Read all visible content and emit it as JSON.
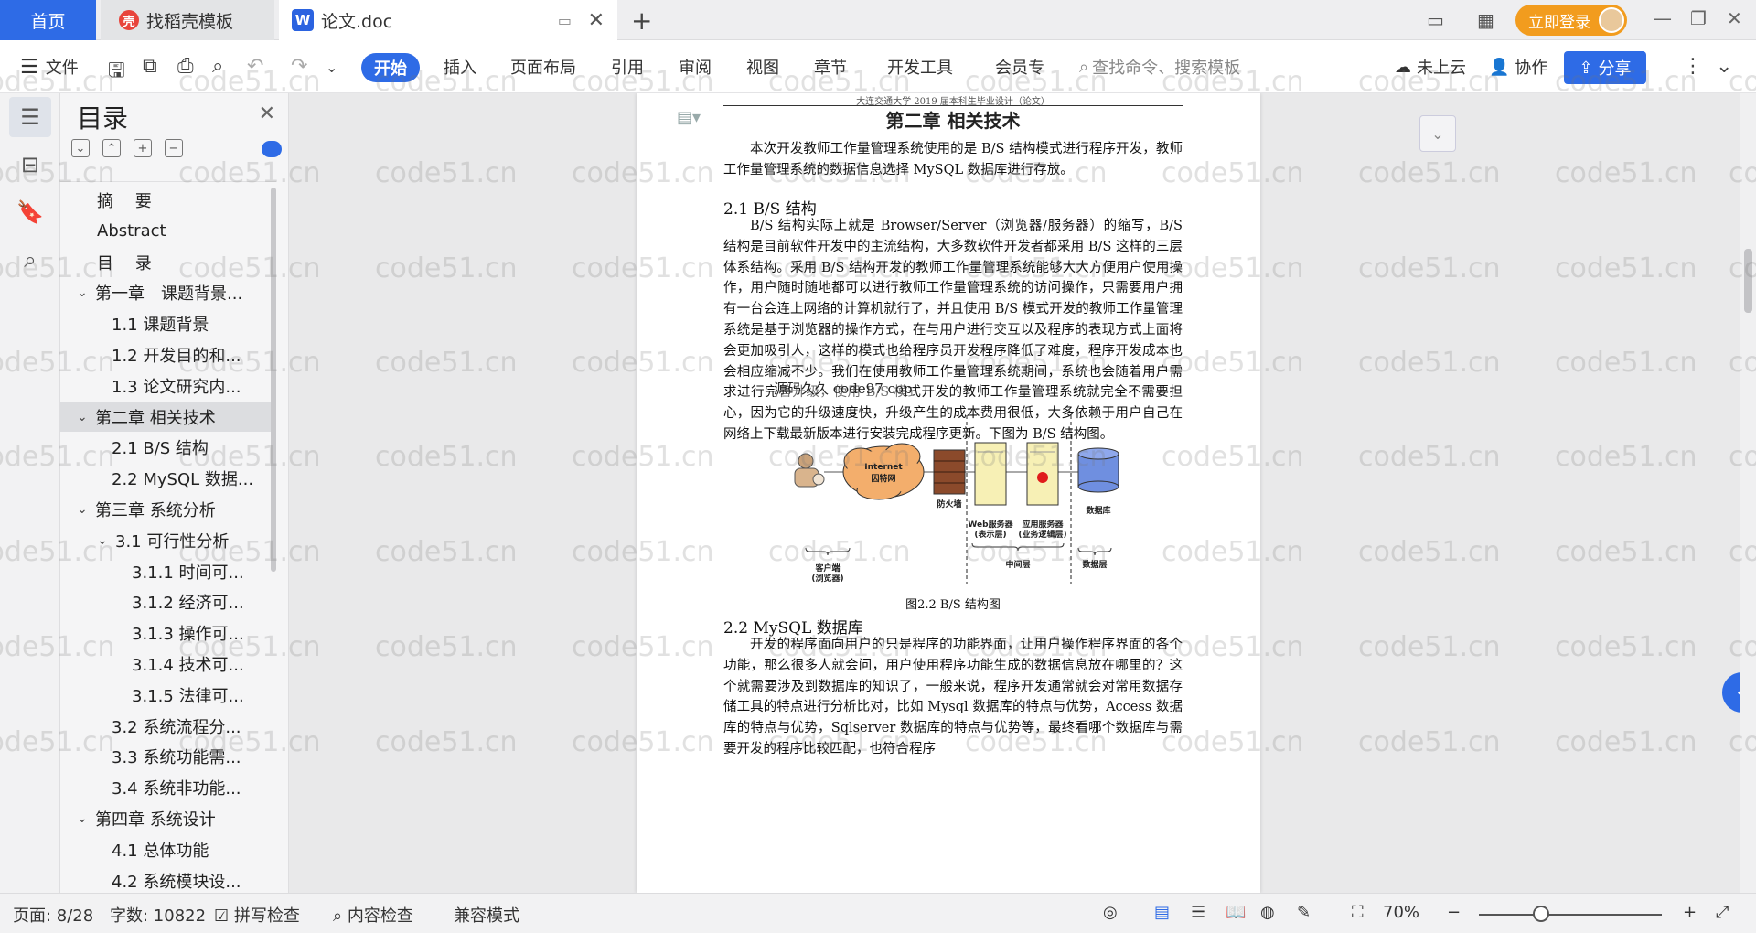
{
  "tabs": {
    "home": "首页",
    "templates": "找稻壳模板",
    "document": "论文.doc"
  },
  "topbar": {
    "login_label": "立即登录"
  },
  "ribbon": {
    "file": "文件",
    "tabs": [
      "开始",
      "插入",
      "页面布局",
      "引用",
      "审阅",
      "视图",
      "章节",
      "开发工具",
      "会员专"
    ],
    "search_placeholder": "查找命令、搜索模板",
    "cloud": "未上云",
    "collab": "协作",
    "share": "分享"
  },
  "toc": {
    "title": "目录",
    "items": [
      {
        "label": "摘　 要",
        "level": 1
      },
      {
        "label": "Abstract",
        "level": 1
      },
      {
        "label": "目　 录",
        "level": 1
      },
      {
        "label": "第一章　课题背景...",
        "level": 0
      },
      {
        "label": "1.1  课题背景",
        "level": 2
      },
      {
        "label": "1.2  开发目的和...",
        "level": 2
      },
      {
        "label": "1.3  论文研究内...",
        "level": 2
      },
      {
        "label": "第二章  相关技术",
        "level": 0
      },
      {
        "label": "2.1 B/S 结构",
        "level": 2
      },
      {
        "label": "2.2 MySQL 数据...",
        "level": 2
      },
      {
        "label": "第三章  系统分析",
        "level": 0
      },
      {
        "label": "3.1 可行性分析",
        "level": 1
      },
      {
        "label": "3.1.1 时间可...",
        "level": 3
      },
      {
        "label": "3.1.2  经济可...",
        "level": 3
      },
      {
        "label": "3.1.3  操作可...",
        "level": 3
      },
      {
        "label": "3.1.4  技术可...",
        "level": 3
      },
      {
        "label": "3.1.5  法律可...",
        "level": 3
      },
      {
        "label": "3.2 系统流程分...",
        "level": 2
      },
      {
        "label": "3.3 系统功能需...",
        "level": 2
      },
      {
        "label": "3.4  系统非功能...",
        "level": 2
      },
      {
        "label": "第四章  系统设计",
        "level": 0
      },
      {
        "label": "4.1  总体功能",
        "level": 2
      },
      {
        "label": "4.2  系统模块设...",
        "level": 2
      }
    ]
  },
  "document": {
    "header": "大连交通大学 2019 届本科生毕业设计（论文）",
    "chapter_title": "第二章  相关技术",
    "intro": "本次开发教师工作量管理系统使用的是 B/S 结构模式进行程序开发，教师工作量管理系统的数据信息选择 MySQL 数据库进行存放。",
    "sec_1": "2.1 B/S 结构",
    "para_1": "B/S 结构实际上就是 Browser/Server（浏览器/服务器）的缩写，B/S 结构是目前软件开发中的主流结构，大多数软件开发者都采用 B/S 这样的三层体系结构。采用 B/S 结构开发的教师工作量管理系统能够大大方便用户使用操作，用户随时随地都可以进行教师工作量管理系统的访问操作，只需要用户拥有一台会连上网络的计算机就行了，并且使用 B/S 模式开发的教师工作量管理系统是基于浏览器的操作方式，在与用户进行交互以及程序的表现方式上面将会更加吸引人，这样的模式也给程序员开发程序降低了难度，程序开发成本也会相应缩减不少。我们在使用教师工作量管理系统期间，系统也会随着用户需求进行完善升级，使用 B/S 模式开发的教师工作量管理系统就完全不需要担心，因为它的升级速度快，升级产生的成本费用很低，大多依赖于用户自己在网络上下载最新版本进行安装完成程序更新。下图为 B/S 结构图。",
    "overlay_note": "源码久久  code97  cop",
    "figure": {
      "internet": "Internet",
      "internet_cn": "因特网",
      "firewall": "防火墙",
      "web_server": "Web服务器",
      "web_server_sub": "(表示层)",
      "app_server": "应用服务器",
      "app_server_sub": "(业务逻辑层)",
      "database": "数据库",
      "client": "客户端",
      "client_sub": "(浏览器)",
      "middle_tier": "中间层",
      "data_tier": "数据层"
    },
    "caption": "图2.2 B/S 结构图",
    "sec_2": "2.2 MySQL 数据库",
    "para_2": "开发的程序面向用户的只是程序的功能界面，让用户操作程序界面的各个功能，那么很多人就会问，用户使用程序功能生成的数据信息放在哪里的？这个就需要涉及到数据库的知识了，一般来说，程序开发通常就会对常用数据存储工具的特点进行分析比对，比如 Mysql 数据库的特点与优势，Access 数据库的特点与优势，Sqlserver 数据库的特点与优势等，最终看哪个数据库与需要开发的程序比较匹配，也符合程序"
  },
  "watermark": "code51.cn",
  "statusbar": {
    "page": "页面: 8/28",
    "words": "字数: 10822",
    "spell": "拼写检查",
    "content_check": "内容检查",
    "compat": "兼容模式",
    "zoom": "70%"
  },
  "colors": {
    "accent": "#2e6be6",
    "login": "#f29c1e"
  }
}
